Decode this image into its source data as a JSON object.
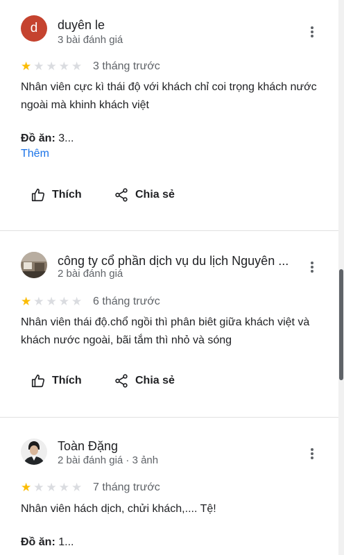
{
  "colors": {
    "star_on": "#fbbc04",
    "star_off": "#dadce0",
    "link": "#1a73e8",
    "avatar_bg": "#c5432f"
  },
  "reviews": [
    {
      "avatar_letter": "d",
      "name": "duyên le",
      "meta": "3 bài đánh giá",
      "rating": 1,
      "date": "3 tháng trước",
      "text": "Nhân viên cực kì thái độ với khách chỉ coi trọng khách nước ngoài mà khinh khách việt",
      "detail_label": "Đồ ăn:",
      "detail_value": "3...",
      "more_label": "Thêm",
      "like_label": "Thích",
      "share_label": "Chia sẻ"
    },
    {
      "avatar_icon": "profile-photo-avatar",
      "name": "công ty cổ phần dịch vụ du lịch Nguyên ...",
      "meta": "2 bài đánh giá",
      "rating": 1,
      "date": "6 tháng trước",
      "text": "Nhân viên thái độ.chổ ngồi thì phân biêt giữa khách việt và khách nước ngoài, bãi tắm thì nhỏ và sóng",
      "like_label": "Thích",
      "share_label": "Chia sẻ"
    },
    {
      "avatar_icon": "profile-photo-avatar",
      "name": "Toàn Đặng",
      "meta": "2 bài đánh giá · 3 ảnh",
      "rating": 1,
      "date": "7 tháng trước",
      "text": "Nhân viên hách dịch, chửi khách,.... Tệ!",
      "detail_label": "Đồ ăn:",
      "detail_value": "1..."
    }
  ]
}
